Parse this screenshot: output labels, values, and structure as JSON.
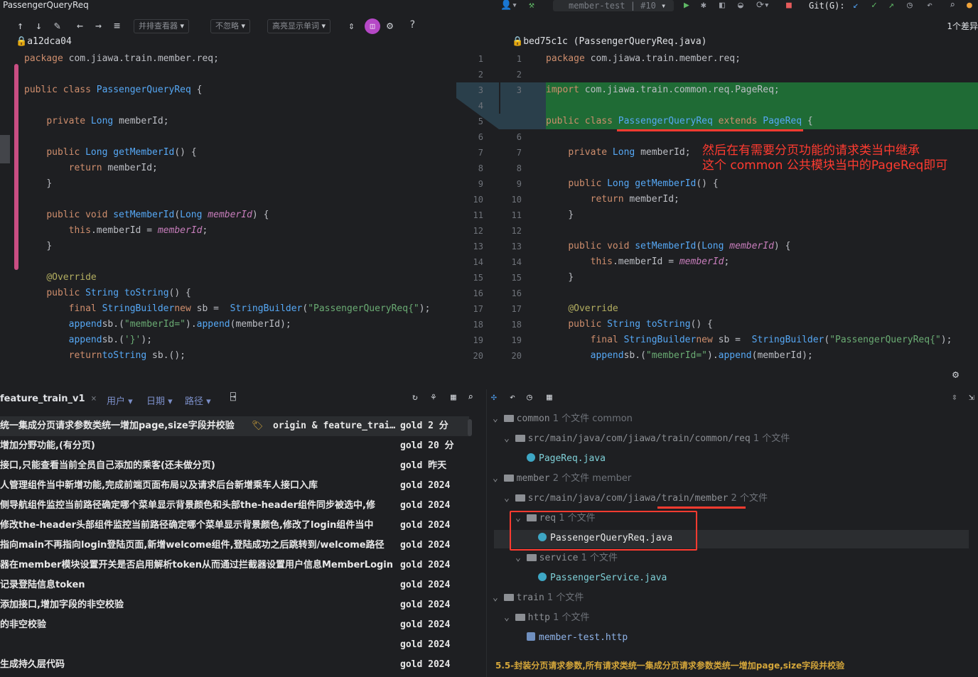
{
  "window": {
    "title": "PassengerQueryReq",
    "run_config": "member-test | #10",
    "git_label": "Git(G):"
  },
  "toolbar": {
    "side_by_side_viewer": "并排查看器",
    "no_ignore": "不忽略",
    "highlight_words": "高亮显示单词",
    "diff_count": "1个差异",
    "help": "?"
  },
  "left_file": {
    "header": "a12dca04"
  },
  "right_file": {
    "header": "bed75c1c (PassengerQueryReq.java)"
  },
  "annotation": {
    "line1": "然后在有需要分页功能的请求类当中继承",
    "line2": "这个 common 公共模块当中的PageReq即可"
  },
  "line_numbers": {
    "left": [
      "1",
      "2",
      "3",
      "4",
      "5",
      "6",
      "7",
      "8",
      "9",
      "10",
      "11",
      "12",
      "13",
      "14",
      "15",
      "16",
      "17",
      "18",
      "19",
      "20"
    ],
    "right": [
      "1",
      "2",
      "3",
      "",
      "",
      "6",
      "7",
      "8",
      "9",
      "10",
      "11",
      "12",
      "13",
      "14",
      "15",
      "16",
      "17",
      "18",
      "19",
      "20"
    ]
  },
  "left_code": [
    {
      "k": "package",
      "r": " com.jiawa.train.member.req;"
    },
    {},
    {
      "k": "public class",
      "c": " PassengerQueryReq",
      "r": " {"
    },
    {},
    {
      "ind": "    ",
      "k": "private",
      "t": " Long",
      "r": " memberId;"
    },
    {},
    {
      "ind": "    ",
      "k": "public",
      "t": " Long",
      "f": " getMemberId",
      "r": "() {"
    },
    {
      "ind": "        ",
      "k": "return",
      "r": " memberId;"
    },
    {
      "ind": "    ",
      "r": "}"
    },
    {},
    {
      "ind": "    ",
      "k": "public void",
      "f": " setMemberId",
      "r": "(",
      "t2": "Long",
      "i": " memberId",
      "r2": ") {"
    },
    {
      "ind": "        ",
      "k": "this",
      "r": ".memberId = ",
      "i2": "memberId",
      "r2": ";"
    },
    {
      "ind": "    ",
      "r": "}"
    },
    {},
    {
      "ind": "    ",
      "a": "@Override"
    },
    {
      "ind": "    ",
      "k": "public",
      "t": " String",
      "f": " toString",
      "r": "() {"
    },
    {
      "ind": "        ",
      "k": "final",
      "t": " StringBuilder",
      "r": " sb = ",
      "k2": "new",
      "t2": " StringBuilder",
      "r2": "(",
      "s": "\"PassengerQueryReq{\"",
      "r3": ");"
    },
    {
      "ind": "        ",
      "r": "sb.",
      "f": "append",
      "r2": "(",
      "s": "\"memberId=\"",
      "r3": ").",
      "f2": "append",
      "r4": "(memberId);"
    },
    {
      "ind": "        ",
      "r": "sb.",
      "f": "append",
      "r2": "(",
      "s": "'}'",
      "r3": ");"
    },
    {
      "ind": "        ",
      "k": "return",
      "r": " sb.",
      "f": "toString",
      "r2": "();"
    }
  ],
  "right_code": [
    {
      "k": "package",
      "r": " com.jiawa.train.member.req;"
    },
    {},
    {
      "k": "import",
      "r": " com.jiawa.train.common.req.PageReq;"
    },
    {},
    {
      "k": "public class",
      "c": " PassengerQueryReq",
      "k2": " extends",
      "c2": " PageReq",
      "r": " {"
    },
    {},
    {
      "ind": "    ",
      "k": "private",
      "t": " Long",
      "r": " memberId;"
    },
    {},
    {
      "ind": "    ",
      "k": "public",
      "t": " Long",
      "f": " getMemberId",
      "r": "() {"
    },
    {
      "ind": "        ",
      "k": "return",
      "r": " memberId;"
    },
    {
      "ind": "    ",
      "r": "}"
    },
    {},
    {
      "ind": "    ",
      "k": "public void",
      "f": " setMemberId",
      "r": "(",
      "t2": "Long",
      "i": " memberId",
      "r2": ") {"
    },
    {
      "ind": "        ",
      "k": "this",
      "r": ".memberId = ",
      "i2": "memberId",
      "r2": ";"
    },
    {
      "ind": "    ",
      "r": "}"
    },
    {},
    {
      "ind": "    ",
      "a": "@Override"
    },
    {
      "ind": "    ",
      "k": "public",
      "t": " String",
      "f": " toString",
      "r": "() {"
    },
    {
      "ind": "        ",
      "k": "final",
      "t": " StringBuilder",
      "r": " sb = ",
      "k2": "new",
      "t2": " StringBuilder",
      "r2": "(",
      "s": "\"PassengerQueryReq{\"",
      "r3": ");"
    },
    {
      "ind": "        ",
      "r": "sb.",
      "f": "append",
      "r2": "(",
      "s": "\"memberId=\"",
      "r3": ").",
      "f2": "append",
      "r4": "(memberId);"
    }
  ],
  "log": {
    "branch": "feature_train_v1",
    "filters": {
      "user": "用户",
      "date": "日期",
      "path": "路径"
    },
    "ref_labels": "origin & feature_trai…",
    "commits": [
      {
        "message": "统一集成分页请求参数类统一增加page,size字段并校验",
        "author": "gold",
        "date": "2 分"
      },
      {
        "message": "增加分野功能,(有分页)",
        "author": "gold",
        "date": "20 分"
      },
      {
        "message": "接口,只能查看当前全员自己添加的乘客(还未做分页)",
        "author": "gold",
        "date": "昨天"
      },
      {
        "message": "人管理组件当中新增功能,完成前端页面布局以及请求后台新增乘车人接口入库",
        "author": "gold",
        "date": "2024"
      },
      {
        "message": "侧导航组件监控当前路径确定哪个菜单显示背景颜色和头部the-header组件同步被选中,修",
        "author": "gold",
        "date": "2024"
      },
      {
        "message": "修改the-header头部组件监控当前路径确定哪个菜单显示背景颜色,修改了login组件当中",
        "author": "gold",
        "date": "2024"
      },
      {
        "message": "指向main不再指向login登陆页面,新增welcome组件,登陆成功之后跳转到/welcome路径",
        "author": "gold",
        "date": "2024"
      },
      {
        "message": "器在member模块设置开关是否启用解析token从而通过拦截器设置用户信息MemberLogin",
        "author": "gold",
        "date": "2024"
      },
      {
        "message": "记录登陆信息token",
        "author": "gold",
        "date": "2024"
      },
      {
        "message": "添加接口,增加字段的非空校验",
        "author": "gold",
        "date": "2024"
      },
      {
        "message": "的非空校验",
        "author": "gold",
        "date": "2024"
      },
      {
        "message": "",
        "author": "gold",
        "date": "2024"
      },
      {
        "message": "生成持久层代码",
        "author": "gold",
        "date": "2024"
      }
    ]
  },
  "files": {
    "tree": [
      {
        "kind": "module",
        "name": "common",
        "count": "1 个文件",
        "extra": "common"
      },
      {
        "kind": "folder",
        "name": "src/main/java/com/jiawa/train/common/req",
        "count": "1 个文件"
      },
      {
        "kind": "java",
        "name": "PageReq.java"
      },
      {
        "kind": "module",
        "name": "member",
        "count": "2 个文件",
        "extra": "member"
      },
      {
        "kind": "folder",
        "name": "src/main/java/com/jiawa/train/member",
        "count": "2 个文件"
      },
      {
        "kind": "folder",
        "name": "req",
        "count": "1 个文件"
      },
      {
        "kind": "java",
        "name": "PassengerQueryReq.java"
      },
      {
        "kind": "folder",
        "name": "service",
        "count": "1 个文件"
      },
      {
        "kind": "java",
        "name": "PassengerService.java"
      },
      {
        "kind": "module",
        "name": "train",
        "count": "1 个文件"
      },
      {
        "kind": "folder",
        "name": "http",
        "count": "1 个文件"
      },
      {
        "kind": "http",
        "name": "member-test.http"
      }
    ],
    "commit_message": "5.5-封装分页请求参数,所有请求类统一集成分页请求参数类统一增加page,size字段并校验"
  },
  "colors": {
    "accent_red": "#ff3b30",
    "diff_green": "#1f6b35",
    "diff_blue": "#2a3f4b",
    "commit_msg": "#d4a63a"
  }
}
